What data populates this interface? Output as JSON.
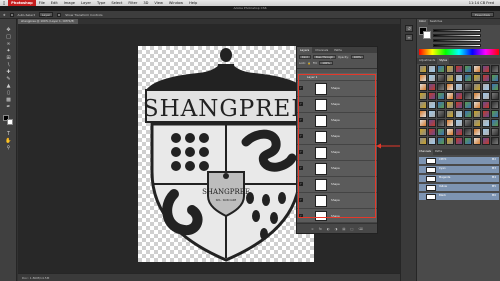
{
  "menubar": {
    "app": "Photoshop",
    "items": [
      "File",
      "Edit",
      "Image",
      "Layer",
      "Type",
      "Select",
      "Filter",
      "3D",
      "View",
      "Window",
      "Help"
    ],
    "clock": "11:14 CB Fred"
  },
  "titlebar": {
    "title": "Adobe Photoshop CS6"
  },
  "optionsbar": {
    "auto_select": "Auto-Select",
    "layer_label": "Layer",
    "show_transform": "Show Transform Controls",
    "workspace": "Essentials"
  },
  "document": {
    "tab_title": "shangpree @ 100% (Layer 1, CMYK/8)",
    "crest_title": "SHANGPREE",
    "badge_text": "SHANGPREE",
    "badge_sub": "SPA · SKIN CARE"
  },
  "statusbar": {
    "text": "Doc: 1.80M/14.5M"
  },
  "layers": {
    "tabs": [
      "Layers",
      "Channels",
      "Paths"
    ],
    "active_tab": "Layers",
    "kind_label": "Kind",
    "blend_mode": "Pass Through",
    "opacity_label": "Opacity:",
    "opacity": "100%",
    "lock_label": "Lock:",
    "fill_label": "Fill:",
    "fill": "100%",
    "group_name": "Layer 1",
    "rows": [
      {
        "name": "Shape"
      },
      {
        "name": "Shape"
      },
      {
        "name": "Shape"
      },
      {
        "name": "Shape"
      },
      {
        "name": "Shape"
      },
      {
        "name": "Shape"
      },
      {
        "name": "Shape"
      },
      {
        "name": "Shape"
      },
      {
        "name": "Shape"
      }
    ],
    "footer_icons": [
      "link-icon",
      "fx-icon",
      "mask-icon",
      "adjustment-icon",
      "folder-icon",
      "new-layer-icon",
      "trash-icon"
    ]
  },
  "right_panels": {
    "color_tabs": [
      "Color",
      "Swatches"
    ],
    "style_tabs": [
      "Adjustments",
      "Styles"
    ],
    "channel_tabs": [
      "Channels",
      "Paths"
    ],
    "channels": [
      {
        "name": "CMYK",
        "key": "⌘2"
      },
      {
        "name": "Cyan",
        "key": "⌘3"
      },
      {
        "name": "Magenta",
        "key": "⌘4"
      },
      {
        "name": "Yellow",
        "key": "⌘5"
      },
      {
        "name": "Black",
        "key": "⌘6"
      }
    ]
  },
  "colors": {
    "accent_red": "#e5382a",
    "channel_selected": "#7d94b2"
  }
}
